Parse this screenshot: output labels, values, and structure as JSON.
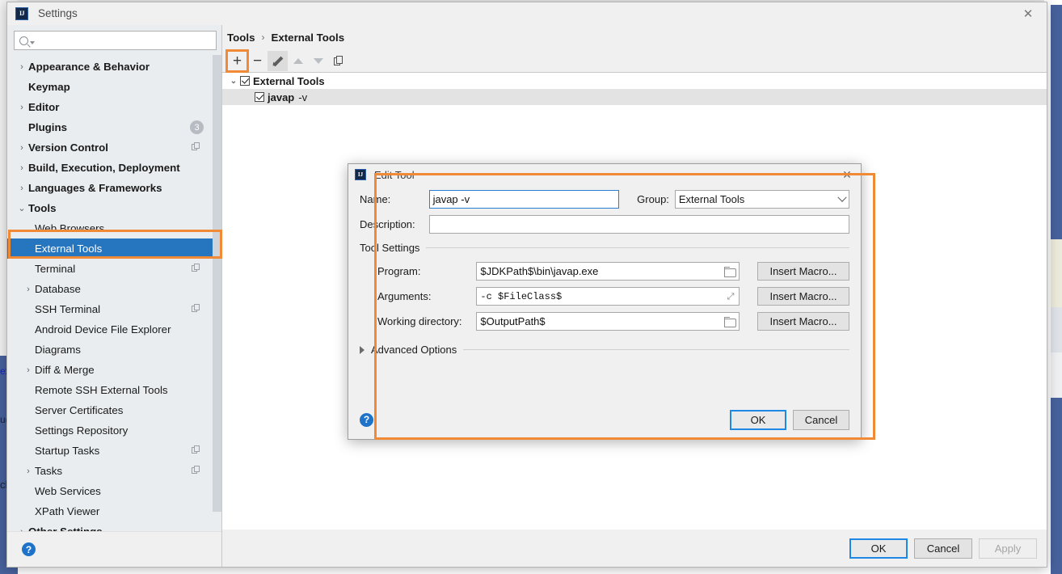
{
  "window": {
    "title": "Settings",
    "logo": "IJ",
    "close_icon": "✕"
  },
  "search": {
    "placeholder": "",
    "value": "",
    "icon": "search-icon"
  },
  "sidebar": {
    "items": [
      {
        "label": "Appearance & Behavior",
        "level": 0,
        "twisty": "›",
        "bold": true
      },
      {
        "label": "Keymap",
        "level": 0,
        "twisty": "",
        "bold": true
      },
      {
        "label": "Editor",
        "level": 0,
        "twisty": "›",
        "bold": true
      },
      {
        "label": "Plugins",
        "level": 0,
        "twisty": "",
        "bold": true,
        "badge": "3"
      },
      {
        "label": "Version Control",
        "level": 0,
        "twisty": "›",
        "bold": true,
        "copy": true
      },
      {
        "label": "Build, Execution, Deployment",
        "level": 0,
        "twisty": "›",
        "bold": true
      },
      {
        "label": "Languages & Frameworks",
        "level": 0,
        "twisty": "›",
        "bold": true
      },
      {
        "label": "Tools",
        "level": 0,
        "twisty": "⌄",
        "bold": true
      },
      {
        "label": "Web Browsers",
        "level": 2,
        "twisty": ""
      },
      {
        "label": "External Tools",
        "level": 2,
        "twisty": "",
        "selected": true
      },
      {
        "label": "Terminal",
        "level": 2,
        "twisty": "",
        "copy": true
      },
      {
        "label": "Database",
        "level": 2,
        "twisty": "›"
      },
      {
        "label": "SSH Terminal",
        "level": 2,
        "twisty": "",
        "copy": true
      },
      {
        "label": "Android Device File Explorer",
        "level": 2,
        "twisty": ""
      },
      {
        "label": "Diagrams",
        "level": 2,
        "twisty": ""
      },
      {
        "label": "Diff & Merge",
        "level": 2,
        "twisty": "›"
      },
      {
        "label": "Remote SSH External Tools",
        "level": 2,
        "twisty": ""
      },
      {
        "label": "Server Certificates",
        "level": 2,
        "twisty": ""
      },
      {
        "label": "Settings Repository",
        "level": 2,
        "twisty": ""
      },
      {
        "label": "Startup Tasks",
        "level": 2,
        "twisty": "",
        "copy": true
      },
      {
        "label": "Tasks",
        "level": 2,
        "twisty": "›",
        "copy": true
      },
      {
        "label": "Web Services",
        "level": 2,
        "twisty": ""
      },
      {
        "label": "XPath Viewer",
        "level": 2,
        "twisty": ""
      },
      {
        "label": "Other Settings",
        "level": 0,
        "twisty": "›",
        "bold": true
      }
    ],
    "help_icon": "?"
  },
  "breadcrumb": {
    "parent": "Tools",
    "separator": "›",
    "current": "External Tools"
  },
  "toolbar": {
    "add_label": "+",
    "remove_label": "−",
    "edit_icon": "pencil-icon",
    "move_up_icon": "triangle-up-icon",
    "move_down_icon": "triangle-down-icon",
    "copy_icon": "copy-icon"
  },
  "tool_tree": {
    "group": {
      "label": "External Tools",
      "checked": true,
      "twisty": "⌄"
    },
    "children": [
      {
        "name": "javap",
        "args": "-v",
        "checked": true,
        "selected": true
      }
    ]
  },
  "footer": {
    "ok": "OK",
    "cancel": "Cancel",
    "apply": "Apply",
    "apply_disabled": true
  },
  "dialog": {
    "title": "Edit Tool",
    "logo": "IJ",
    "close_icon": "✕",
    "name_label": "Name:",
    "name_value": "javap -v",
    "group_label": "Group:",
    "group_value": "External Tools",
    "description_label": "Description:",
    "description_value": "",
    "tool_settings_legend": "Tool Settings",
    "program_label": "Program:",
    "program_value": "$JDKPath$\\bin\\javap.exe",
    "arguments_label": "Arguments:",
    "arguments_value": "-c $FileClass$",
    "working_dir_label": "Working directory:",
    "working_dir_value": "$OutputPath$",
    "insert_macro_label": "Insert Macro...",
    "advanced_options_label": "Advanced Options",
    "advanced_twisty": "▸",
    "help_icon": "?",
    "ok": "OK",
    "cancel": "Cancel"
  },
  "annotations": {
    "accent_color": "#f08a36",
    "highlight_dialog": "edit-tool-dialog-highlight",
    "highlight_sidebar": "external-tools-item-highlight",
    "highlight_add": "add-tool-button-highlight"
  },
  "colors": {
    "selection_blue": "#2675bf",
    "default_button_border": "#1e88e5",
    "sidebar_bg": "#e9edf0",
    "panel_bg": "#f0f0f0",
    "orange": "#f08a36"
  }
}
